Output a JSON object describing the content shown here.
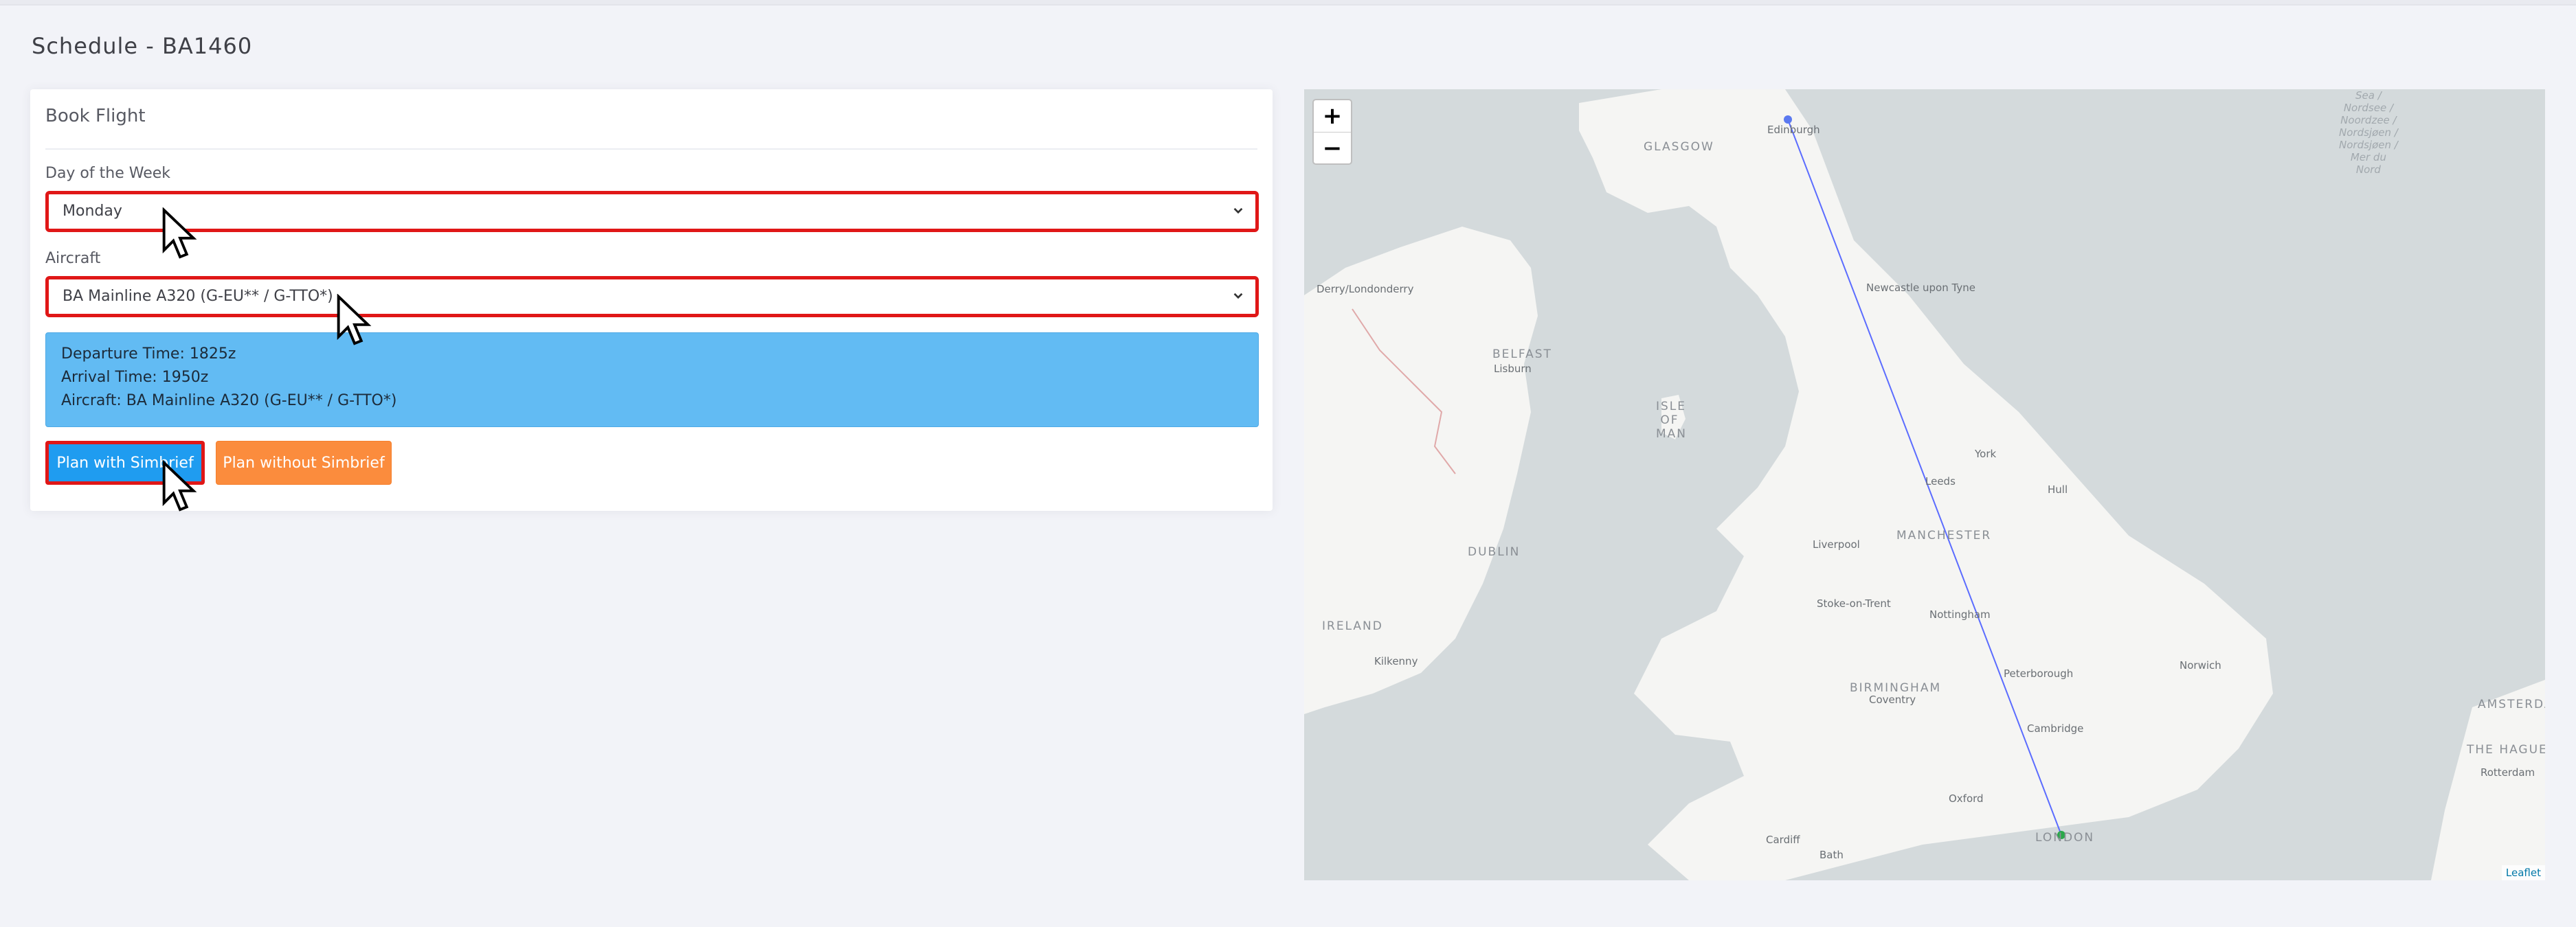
{
  "page": {
    "title": "Schedule - BA1460"
  },
  "card": {
    "title": "Book Flight",
    "day_label": "Day of the Week",
    "day_value": "Monday",
    "aircraft_label": "Aircraft",
    "aircraft_value": "BA Mainline A320 (G-EU** / G-TTO*)"
  },
  "info": {
    "departure": "Departure Time: 1825z",
    "arrival": "Arrival Time: 1950z",
    "aircraft": "Aircraft: BA Mainline A320 (G-EU** / G-TTO*)"
  },
  "buttons": {
    "plan_simbrief": "Plan with Simbrief",
    "plan_without": "Plan without Simbrief"
  },
  "map": {
    "zoom_in": "+",
    "zoom_out": "−",
    "attribution": "Leaflet",
    "labels": {
      "edinburgh": "Edinburgh",
      "glasgow": "GLASGOW",
      "derry": "Derry/Londonderry",
      "newcastle": "Newcastle upon Tyne",
      "belfast": "BELFAST",
      "lisburn": "Lisburn",
      "isle_of_man": "ISLE OF MAN",
      "york": "York",
      "leeds": "Leeds",
      "hull": "Hull",
      "dublin": "DUBLIN",
      "liverpool": "Liverpool",
      "manchester": "MANCHESTER",
      "ireland": "IRELAND",
      "stoke": "Stoke-on-Trent",
      "nottingham": "Nottingham",
      "kilkenny": "Kilkenny",
      "peterborough": "Peterborough",
      "norwich": "Norwich",
      "birmingham": "BIRMINGHAM",
      "coventry": "Coventry",
      "cambridge": "Cambridge",
      "amsterdam": "AMSTERDAM",
      "the_hague": "THE HAGUE",
      "rotterdam": "Rotterdam",
      "oxford": "Oxford",
      "cardiff": "Cardiff",
      "bath": "Bath",
      "london": "LONDON",
      "north_sea": "Sea /\nNordsee /\nNoordzee /\nNordsjøen /\nNordsjøen /\nMer du\nNord"
    }
  }
}
